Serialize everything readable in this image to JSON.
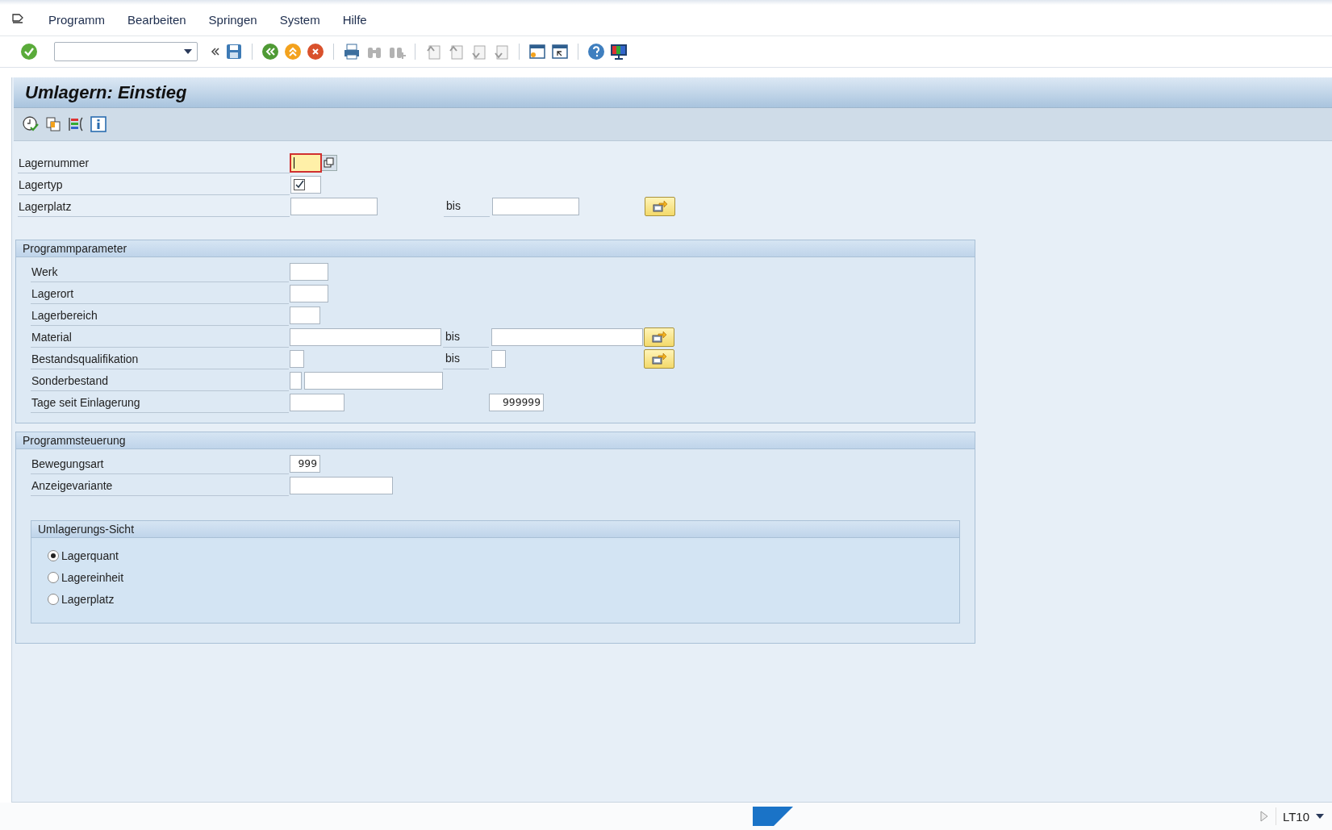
{
  "menu": [
    "Programm",
    "Bearbeiten",
    "Springen",
    "System",
    "Hilfe"
  ],
  "title": "Umlagern: Einstieg",
  "sections": [
    {
      "rows": [
        {
          "label": "Lagernummer",
          "fields": [
            {
              "kind": "input",
              "focused": true
            }
          ],
          "value_help": true
        },
        {
          "label": "Lagertyp",
          "fields": [
            {
              "kind": "checkbox",
              "checked": true
            }
          ]
        },
        {
          "label": "Lagerplatz",
          "fields": [
            {
              "kind": "input"
            }
          ],
          "to": {
            "label": "bis",
            "fields": [
              {
                "kind": "input"
              }
            ]
          },
          "multi_select": true
        }
      ]
    },
    {
      "title": "Programmparameter",
      "rows": [
        {
          "label": "Werk",
          "fields": [
            {
              "kind": "input"
            }
          ]
        },
        {
          "label": "Lagerort",
          "fields": [
            {
              "kind": "input"
            }
          ]
        },
        {
          "label": "Lagerbereich",
          "fields": [
            {
              "kind": "input"
            }
          ]
        },
        {
          "label": "Material",
          "fields": [
            {
              "kind": "input"
            }
          ],
          "to": {
            "label": "bis",
            "fields": [
              {
                "kind": "input"
              }
            ]
          },
          "multi_select": true
        },
        {
          "label": "Bestandsqualifikation",
          "fields": [
            {
              "kind": "input"
            }
          ],
          "to": {
            "label": "bis",
            "fields": [
              {
                "kind": "input"
              }
            ]
          },
          "multi_select": true
        },
        {
          "label": "Sonderbestand",
          "fields": [
            {
              "kind": "input"
            },
            {
              "kind": "input"
            }
          ]
        },
        {
          "label": "Tage seit Einlagerung",
          "fields": [
            {
              "kind": "input"
            }
          ],
          "to": {
            "fields": [
              {
                "kind": "input",
                "value": "999999"
              }
            ]
          }
        }
      ]
    },
    {
      "title": "Programmsteuerung",
      "rows": [
        {
          "label": "Bewegungsart",
          "fields": [
            {
              "kind": "input",
              "value": "999"
            }
          ]
        },
        {
          "label": "Anzeigevariante",
          "fields": [
            {
              "kind": "input"
            }
          ]
        }
      ],
      "radio_group": {
        "title": "Umlagerungs-Sicht",
        "options": [
          {
            "label": "Lagerquant",
            "selected": true
          },
          {
            "label": "Lagereinheit",
            "selected": false
          },
          {
            "label": "Lagerplatz",
            "selected": false
          }
        ]
      }
    }
  ],
  "status_bar": {
    "transaction": "LT10"
  }
}
